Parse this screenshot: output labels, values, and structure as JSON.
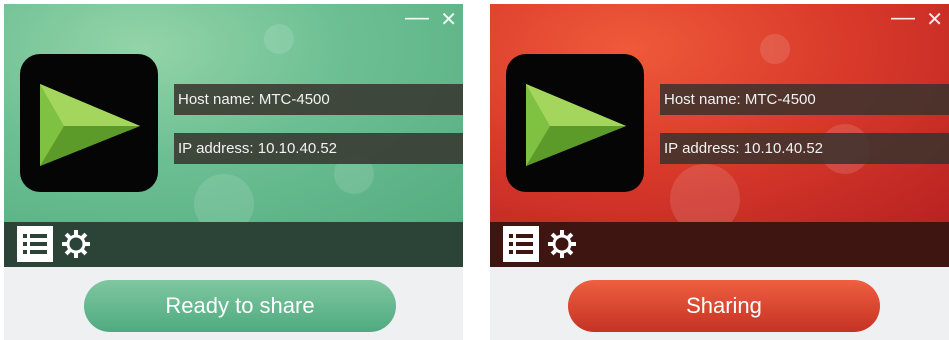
{
  "panels": [
    {
      "state": "ready",
      "accent": "#6cbf93",
      "window_controls": {
        "minimize": "—",
        "close": "✕"
      },
      "host_name": "Host name: MTC-4500",
      "ip_address": "IP address: 10.10.40.52",
      "toolbar": {
        "list_icon": "list-icon",
        "settings_icon": "gear-icon"
      },
      "action_label": "Ready to share"
    },
    {
      "state": "sharing",
      "accent": "#d8392a",
      "window_controls": {
        "minimize": "—",
        "close": "✕"
      },
      "host_name": "Host name: MTC-4500",
      "ip_address": "IP address: 10.10.40.52",
      "toolbar": {
        "list_icon": "list-icon",
        "settings_icon": "gear-icon"
      },
      "action_label": "Sharing"
    }
  ]
}
